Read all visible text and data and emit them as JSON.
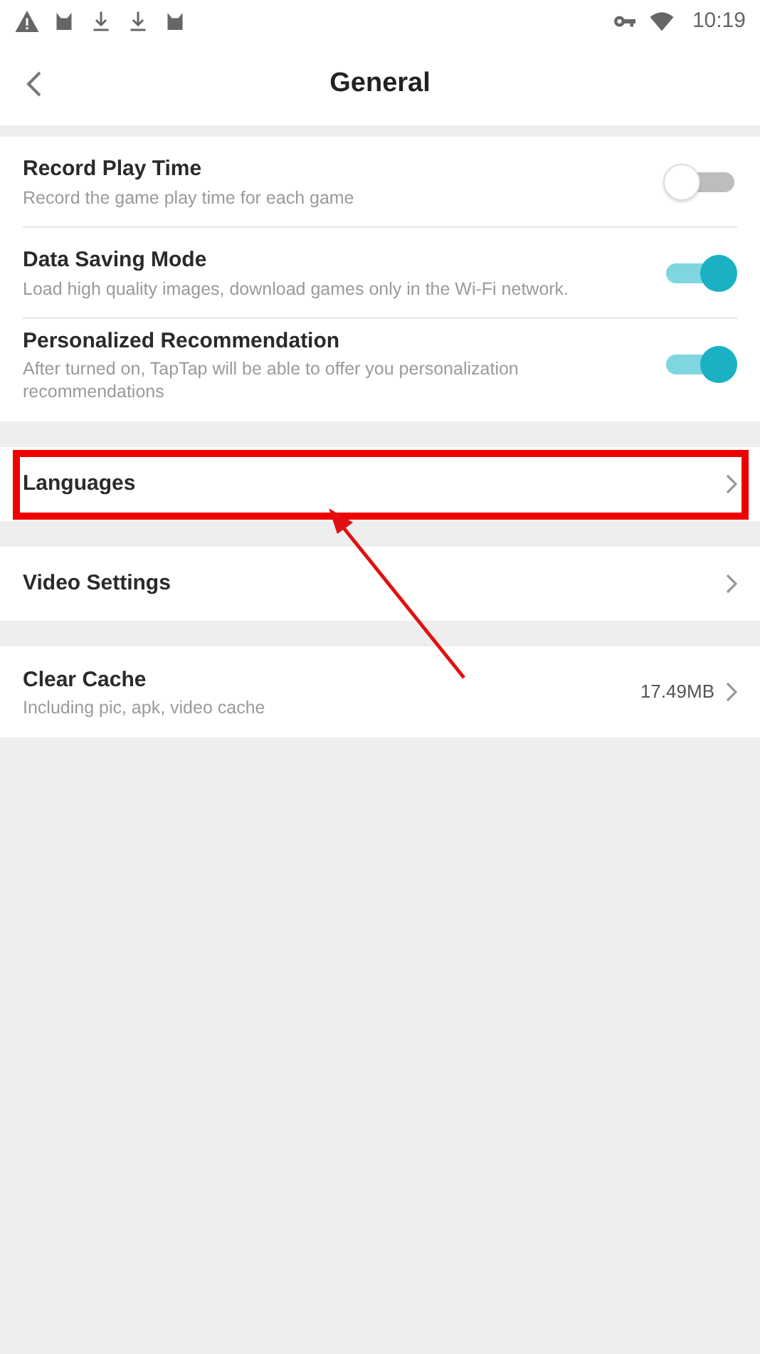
{
  "status_bar": {
    "time": "10:19"
  },
  "header": {
    "title": "General"
  },
  "toggles": [
    {
      "title": "Record Play Time",
      "description": "Record the game play time for each game",
      "on": false
    },
    {
      "title": "Data Saving Mode",
      "description": "Load high quality images, download games only in the Wi-Fi network.",
      "on": true
    },
    {
      "title": "Personalized Recommendation",
      "description": "After turned on, TapTap will be able to offer you personalization recommendations",
      "on": true
    }
  ],
  "sections": [
    {
      "title": "Languages",
      "highlighted": true
    },
    {
      "title": "Video Settings",
      "highlighted": false
    },
    {
      "title": "Clear Cache",
      "description": "Including pic, apk, video cache",
      "value": "17.49MB",
      "highlighted": false
    }
  ]
}
